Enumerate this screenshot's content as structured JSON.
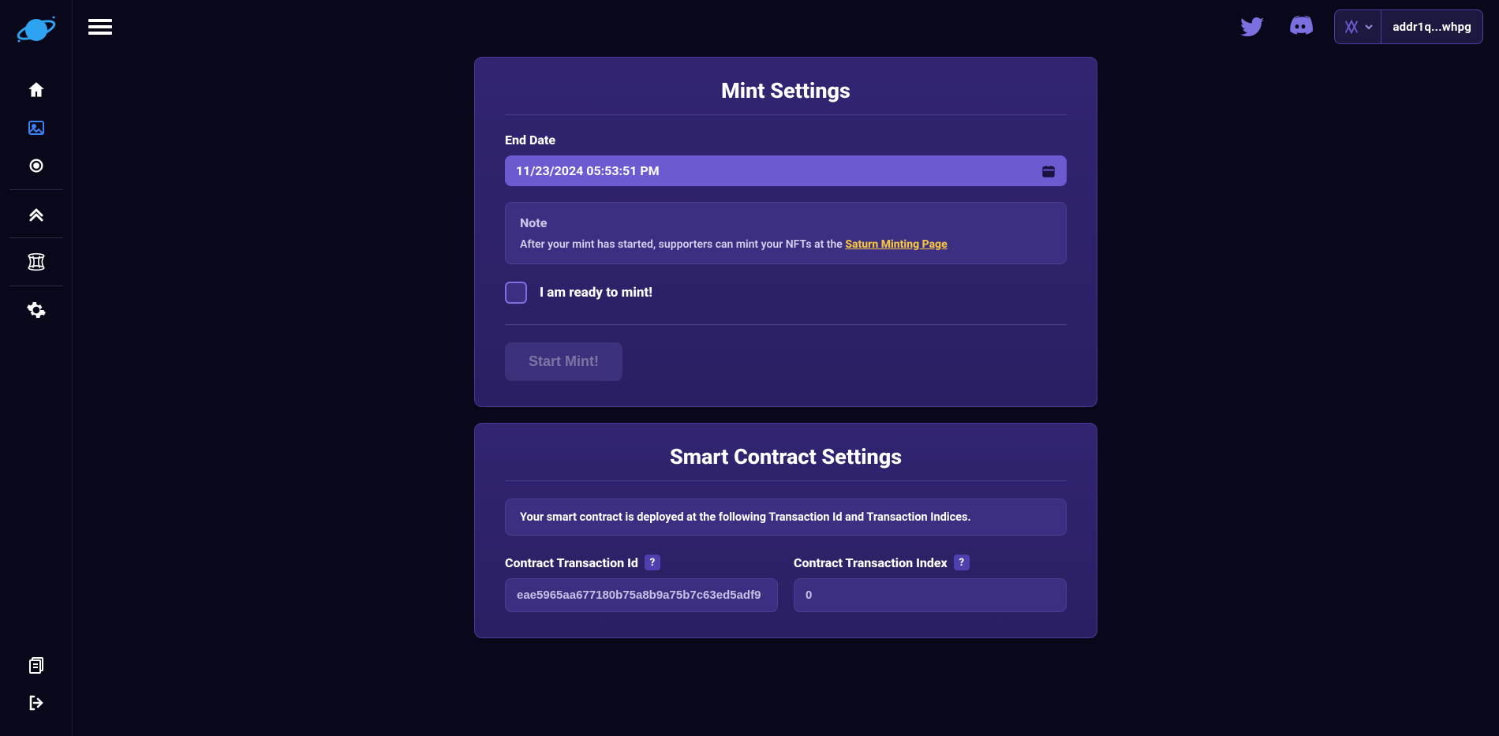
{
  "topbar": {
    "wallet_address": "addr1q...whpg"
  },
  "mint_settings": {
    "title": "Mint Settings",
    "end_date_label": "End Date",
    "end_date_value": "11/23/2024 05:53:51 PM",
    "note_title": "Note",
    "note_text_prefix": "After your mint has started, supporters can mint your NFTs at the ",
    "note_link_text": "Saturn Minting Page",
    "ready_checkbox_label": "I am ready to mint!",
    "start_button": "Start Mint!"
  },
  "smart_contract": {
    "title": "Smart Contract Settings",
    "info_text": "Your smart contract is deployed at the following Transaction Id and Transaction Indices.",
    "tx_id_label": "Contract Transaction Id",
    "tx_id_value": "eae5965aa677180b75a8b9a75b7c63ed5adf9",
    "tx_index_label": "Contract Transaction Index",
    "tx_index_value": "0",
    "help_glyph": "?"
  }
}
